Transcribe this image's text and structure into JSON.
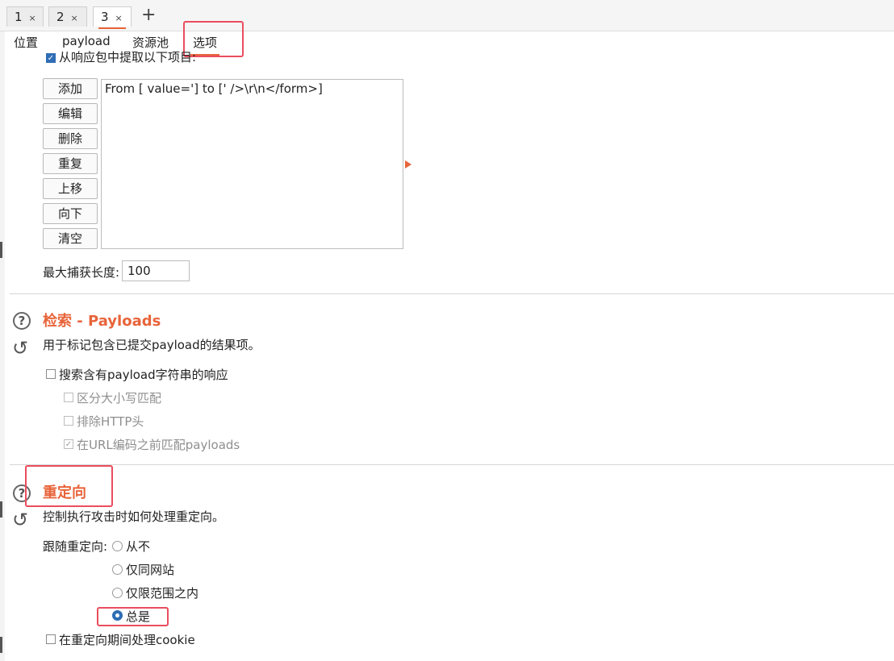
{
  "top_tabs": [
    {
      "label": "1",
      "close": "×"
    },
    {
      "label": "2",
      "close": "×"
    },
    {
      "label": "3",
      "close": "×"
    }
  ],
  "new_tab_icon": "+",
  "sub_tabs": [
    "位置",
    "payload",
    "资源池",
    "选项"
  ],
  "grep_extract": {
    "checkbox_label": "从响应包中提取以下项目:",
    "buttons": [
      "添加",
      "编辑",
      "删除",
      "重复",
      "上移",
      "向下",
      "清空"
    ],
    "items": [
      "From [ value='] to [' />\\r\\n</form>]"
    ],
    "max_capture_label": "最大捕获长度:",
    "max_capture_value": "100"
  },
  "grep_payloads": {
    "title": "检索 - Payloads",
    "description": "用于标记包含已提交payload的结果项。",
    "search_label": "搜索含有payload字符串的响应",
    "case_sensitive_label": "区分大小写匹配",
    "exclude_http_label": "排除HTTP头",
    "match_before_url_label": "在URL编码之前匹配payloads"
  },
  "redirections": {
    "title": "重定向",
    "description": "控制执行攻击时如何处理重定向。",
    "follow_label": "跟随重定向:",
    "options": [
      "从不",
      "仅同网站",
      "仅限范围之内",
      "总是"
    ],
    "selected": "总是",
    "cookie_label": "在重定向期间处理cookie"
  },
  "icons": {
    "help": "?",
    "reset": "↺"
  },
  "colors": {
    "accent": "#e8643a",
    "highlight_box": "#ea4d5e",
    "checkbox_on": "#2f6db5"
  }
}
